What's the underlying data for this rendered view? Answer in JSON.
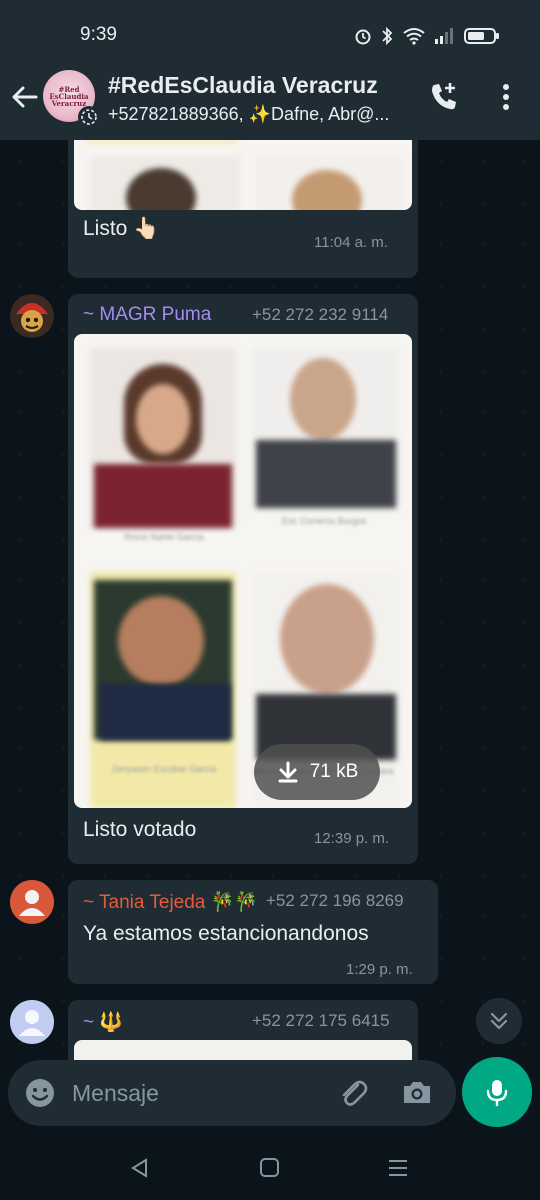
{
  "status_bar": {
    "time": "9:39"
  },
  "header": {
    "group_name": "#RedEsClaudia Veracruz",
    "members": "+527821889366, ✨Dafne, Abr@...",
    "avatar_logo_text": "#Red EsClaudia Veracruz"
  },
  "messages": [
    {
      "type": "image_partial",
      "text": "Listo 👆🏻",
      "time": "11:04 a. m."
    },
    {
      "sender": "~ MAGR Puma",
      "sender_color": "#a48cf1",
      "phone": "+52 272 232 9114",
      "download_size": "71 kB",
      "text": "Listo votado",
      "time": "12:39 p. m."
    },
    {
      "sender": "~ Tania Tejeda 🎋🎋",
      "sender_color": "#e25c3c",
      "phone": "+52 272 196 8269",
      "text": "Ya estamos estancionandonos",
      "time": "1:29 p. m."
    },
    {
      "sender": "~ 🔱",
      "sender_color": "#a48cf1",
      "phone": "+52 272 175 6415"
    }
  ],
  "input": {
    "placeholder": "Mensaje"
  },
  "colors": {
    "accent": "#00a884",
    "header_bg": "#1f2c33",
    "bubble_bg": "#202c33",
    "chat_bg": "#0b141a"
  },
  "icons": [
    "back-arrow-icon",
    "add-call-icon",
    "more-vert-icon",
    "emoji-icon",
    "attach-icon",
    "camera-icon",
    "mic-icon",
    "download-icon",
    "double-chevron-down-icon"
  ]
}
